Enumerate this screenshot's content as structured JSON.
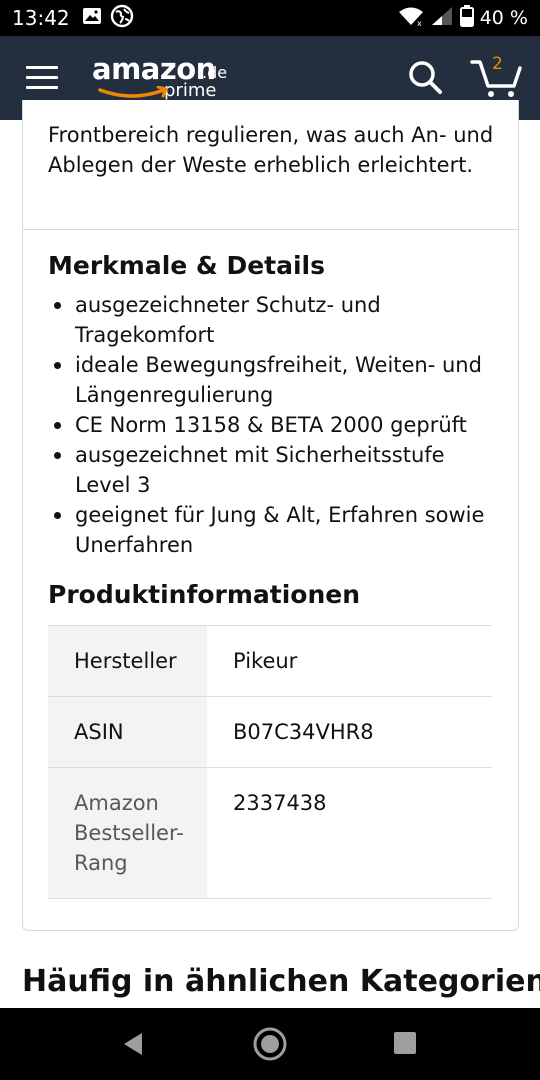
{
  "status_bar": {
    "time": "13:42",
    "battery": "40 %",
    "icons": [
      "image-icon",
      "globe-icon",
      "wifi-icon",
      "signal-icon",
      "battery-icon"
    ]
  },
  "header": {
    "logo_text": "amazon",
    "logo_tld": ".de",
    "logo_prime": "prime",
    "cart_count": "2",
    "bg_color": "#232f3e",
    "accent_color": "#f08804"
  },
  "description": {
    "text": "Frontbereich regulieren, was auch An- und Ablegen der Weste erheblich erleichtert."
  },
  "features": {
    "title": "Merkmale & Details",
    "items": [
      "ausgezeichneter Schutz- und Tragekomfort",
      "ideale Bewegungsfreiheit, Weiten- und Längenregulierung",
      "CE Norm 13158 & BETA 2000 geprüft",
      "ausgezeichnet mit Sicherheitsstufe Level 3",
      "geeignet für Jung & Alt, Erfahren sowie Unerfahren"
    ]
  },
  "product_info": {
    "title": "Produktinformationen",
    "rows": [
      {
        "key": "Hersteller",
        "value": "Pikeur"
      },
      {
        "key": "ASIN",
        "value": "B07C34VHR8"
      },
      {
        "key": "Amazon Bestseller-Rang",
        "value": "2337438"
      }
    ]
  },
  "similar": {
    "title": "Häufig in ähnlichen Kategorien"
  }
}
